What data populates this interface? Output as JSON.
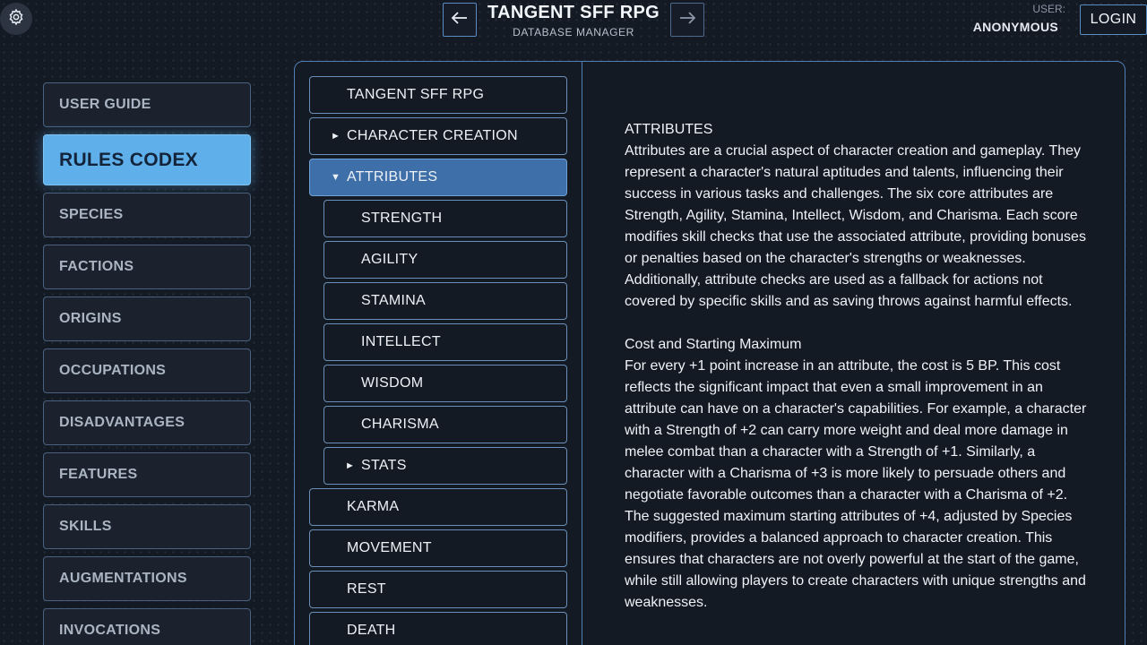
{
  "header": {
    "title": "TANGENT SFF RPG",
    "subtitle": "DATABASE MANAGER",
    "user_label": "USER:",
    "user_name": "ANONYMOUS",
    "login_label": "LOGIN",
    "prev_icon": "arrow-left-icon",
    "next_icon": "arrow-right-icon",
    "settings_icon": "gear-icon"
  },
  "sidebar": {
    "items": [
      {
        "label": "USER GUIDE"
      },
      {
        "label": "RULES CODEX"
      },
      {
        "label": "SPECIES"
      },
      {
        "label": "FACTIONS"
      },
      {
        "label": "ORIGINS"
      },
      {
        "label": "OCCUPATIONS"
      },
      {
        "label": "DISADVANTAGES"
      },
      {
        "label": "FEATURES"
      },
      {
        "label": "SKILLS"
      },
      {
        "label": "AUGMENTATIONS"
      },
      {
        "label": "INVOCATIONS"
      }
    ],
    "active": "RULES CODEX"
  },
  "tree": {
    "items": [
      {
        "label": "TANGENT SFF RPG",
        "caret": ""
      },
      {
        "label": "CHARACTER CREATION",
        "caret": "►"
      },
      {
        "label": "ATTRIBUTES",
        "caret": "▼"
      },
      {
        "label": "STRENGTH",
        "caret": ""
      },
      {
        "label": "AGILITY",
        "caret": ""
      },
      {
        "label": "STAMINA",
        "caret": ""
      },
      {
        "label": "INTELLECT",
        "caret": ""
      },
      {
        "label": "WISDOM",
        "caret": ""
      },
      {
        "label": "CHARISMA",
        "caret": ""
      },
      {
        "label": "STATS",
        "caret": "►"
      },
      {
        "label": "KARMA",
        "caret": ""
      },
      {
        "label": "MOVEMENT",
        "caret": ""
      },
      {
        "label": "REST",
        "caret": ""
      },
      {
        "label": "DEATH",
        "caret": ""
      }
    ]
  },
  "content": {
    "heading": "ATTRIBUTES",
    "intro": "Attributes are a crucial aspect of character creation and gameplay. They represent a character's natural aptitudes and talents, influencing their success in various tasks and challenges. The six core attributes are Strength, Agility, Stamina, Intellect, Wisdom, and Charisma. Each score modifies skill checks that use the associated attribute, providing bonuses or penalties based on the character's strengths or weaknesses. Additionally, attribute checks are used as a fallback for actions not covered by specific skills and as saving throws against harmful effects.",
    "section_heading": "Cost and Starting Maximum",
    "para1": "For every +1 point increase in an attribute, the cost is 5 BP. This cost reflects the significant impact that even a small improvement in an attribute can have on a character's capabilities. For example, a character with a Strength of +2 can carry more weight and deal more damage in melee combat than a character with a Strength of +1. Similarly, a character with a Charisma of +3 is more likely to persuade others and negotiate favorable outcomes than a character with a Charisma of +2.",
    "para2": "The suggested maximum starting attributes of +4, adjusted by Species modifiers, provides a balanced approach to character creation. This ensures that characters are not overly powerful at the start of the game, while still allowing players to create characters with unique strengths and weaknesses."
  },
  "colors": {
    "background": "#141a24",
    "accent": "#5fb0ea",
    "tree_active": "#3f6fa8",
    "border": "#4f7fb4"
  }
}
